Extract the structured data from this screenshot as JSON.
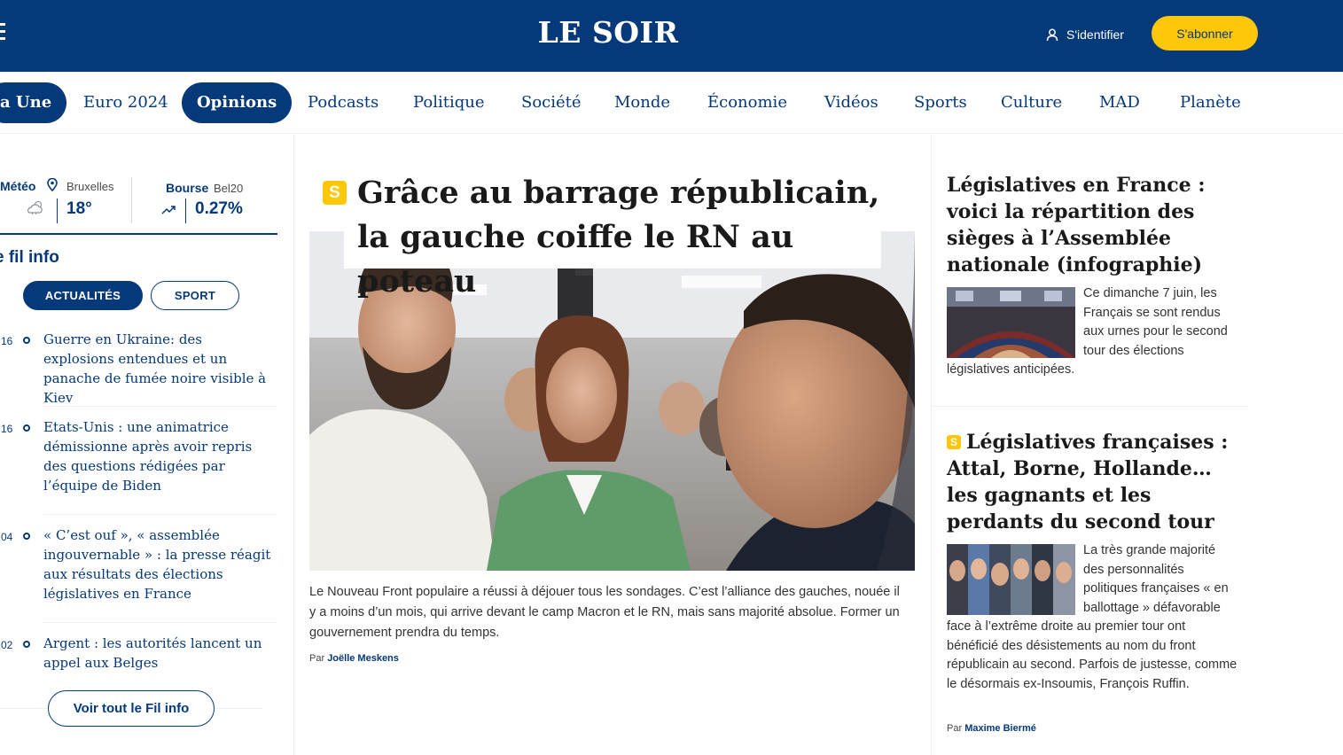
{
  "header": {
    "logo": "LE SOIR",
    "login_label": "S'identifier",
    "subscribe_label": "S'abonner"
  },
  "nav": {
    "items": [
      {
        "label": "a Une"
      },
      {
        "label": "Euro 2024"
      },
      {
        "label": "Opinions"
      },
      {
        "label": "Podcasts"
      },
      {
        "label": "Politique"
      },
      {
        "label": "Société"
      },
      {
        "label": "Monde"
      },
      {
        "label": "Économie"
      },
      {
        "label": "Vidéos"
      },
      {
        "label": "Sports"
      },
      {
        "label": "Culture"
      },
      {
        "label": "MAD"
      },
      {
        "label": "Planète"
      }
    ]
  },
  "widgets": {
    "weather": {
      "title": "Météo",
      "city": "Bruxelles",
      "temperature": "18°"
    },
    "stock": {
      "title": "Bourse",
      "index": "Bel20",
      "value": "0.27%"
    }
  },
  "fil_info": {
    "title": "e fil info",
    "tabs": [
      "ACTUALITÉS",
      "SPORT"
    ],
    "items": [
      {
        "time": "16",
        "headline": "Guerre en Ukraine: des explosions entendues et un panache de fumée noire visible à Kiev"
      },
      {
        "time": "16",
        "headline": "Etats-Unis : une animatrice démissionne après avoir repris des questions rédigées par l’équipe de Biden"
      },
      {
        "time": "04",
        "headline": "« C’est ouf », « assemblée ingouvernable » : la presse réagit aux résultats des élections législatives en France"
      },
      {
        "time": "02",
        "headline": "Argent : les autorités lancent un appel aux Belges"
      }
    ],
    "see_all": "Voir tout le Fil info"
  },
  "main_story": {
    "badge": "S",
    "title": "Grâce au barrage républicain, la gauche coiffe le RN au poteau",
    "chapo": "Le Nouveau Front populaire a réussi à déjouer tous les sondages. C’est l’alliance des gauches, nouée il y a moins d’un mois, qui arrive devant le camp Macron et le RN, mais sans majorité absolue. Former un gouvernement prendra du temps.",
    "byline_prefix": "Par",
    "author": "Joëlle Meskens"
  },
  "right_stories": [
    {
      "title": "Législatives en France : voici la répartition des sièges à l’Assemblée nationale (infographie)",
      "text": "Ce dimanche 7 juin, les Français se sont rendus aux urnes pour le second tour des élections législatives anticipées."
    },
    {
      "badge": "S",
      "title": "Législatives françaises : Attal, Borne, Hollande… les gagnants et les perdants du second tour",
      "text": "La très grande majorité des personnalités politiques françaises « en ballottage » défavorable face à l’extrême droite au premier tour ont bénéficié des désistements au nom du front républicain au second. Parfois de justesse, comme le désormais ex-Insoumis, François Ruffin.",
      "byline_prefix": "Par",
      "author": "Maxime Biermé"
    }
  ],
  "colors": {
    "brand": "#05397a",
    "accent": "#ffc709"
  }
}
